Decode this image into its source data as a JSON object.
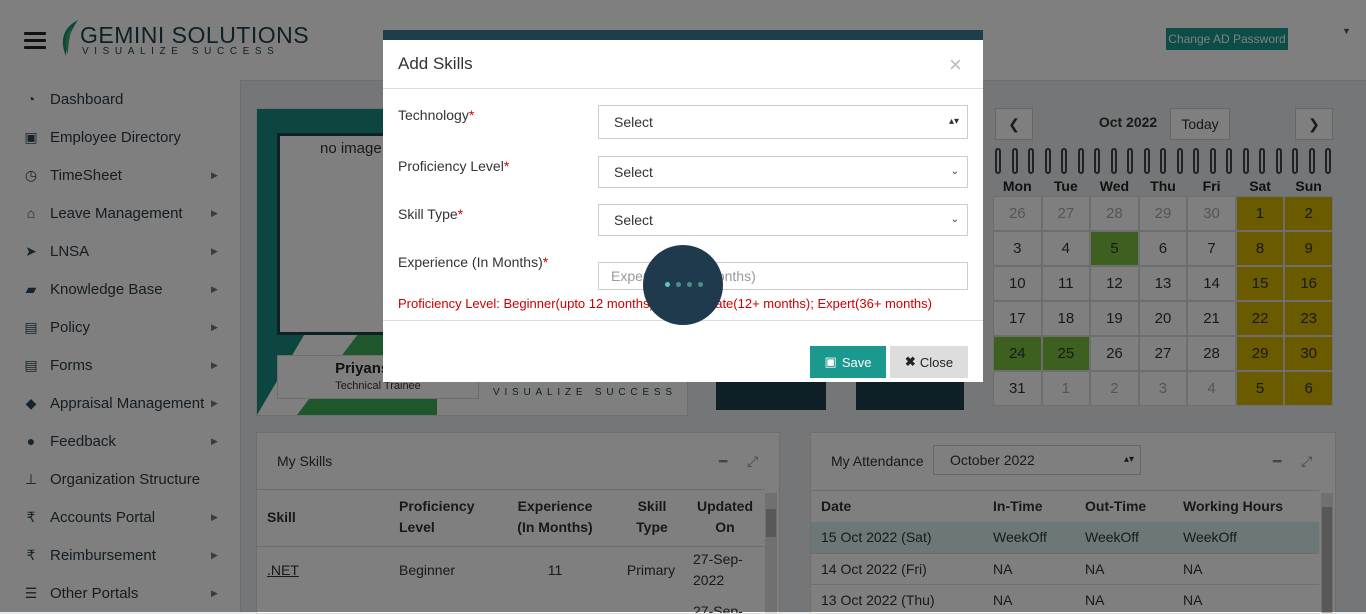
{
  "header": {
    "logo_name": "GEMINI SOLUTIONS",
    "logo_tagline": "VISUALIZE SUCCESS",
    "change_password_label": "Change AD Password"
  },
  "sidebar": {
    "items": [
      {
        "label": "Dashboard",
        "icon": "dashboard-icon"
      },
      {
        "label": "Employee Directory",
        "icon": "id-card-icon"
      },
      {
        "label": "TimeSheet",
        "icon": "clock-icon"
      },
      {
        "label": "Leave Management",
        "icon": "home-icon"
      },
      {
        "label": "LNSA",
        "icon": "send-icon"
      },
      {
        "label": "Knowledge Base",
        "icon": "folder-open-icon"
      },
      {
        "label": "Policy",
        "icon": "file-icon"
      },
      {
        "label": "Forms",
        "icon": "document-icon"
      },
      {
        "label": "Appraisal Management",
        "icon": "graduation-cap-icon"
      },
      {
        "label": "Feedback",
        "icon": "comments-icon"
      },
      {
        "label": "Organization Structure",
        "icon": "sitemap-icon"
      },
      {
        "label": "Accounts Portal",
        "icon": "rupee-icon"
      },
      {
        "label": "Reimbursement",
        "icon": "rupee-icon"
      },
      {
        "label": "Other Portals",
        "icon": "list-icon"
      }
    ]
  },
  "profile": {
    "image_alt": "no image",
    "name": "Priyanshu F",
    "designation": "Technical Trainee",
    "tagline": "VISUALIZE SUCCESS"
  },
  "calendar": {
    "title": "Oct 2022",
    "today_label": "Today",
    "prev_label": "❮",
    "next_label": "❯",
    "days": [
      "Mon",
      "Tue",
      "Wed",
      "Thu",
      "Fri",
      "Sat",
      "Sun"
    ],
    "weeks": [
      [
        "26",
        "27",
        "28",
        "29",
        "30",
        "1",
        "2"
      ],
      [
        "3",
        "4",
        "5",
        "6",
        "7",
        "8",
        "9"
      ],
      [
        "10",
        "11",
        "12",
        "13",
        "14",
        "15",
        "16"
      ],
      [
        "17",
        "18",
        "19",
        "20",
        "21",
        "22",
        "23"
      ],
      [
        "24",
        "25",
        "26",
        "27",
        "28",
        "29",
        "30"
      ],
      [
        "31",
        "1",
        "2",
        "3",
        "4",
        "5",
        "6"
      ]
    ]
  },
  "skills": {
    "title": "My Skills",
    "headers": [
      "Skill",
      "Proficiency Level",
      "Experience (In Months)",
      "Skill Type",
      "Updated On"
    ],
    "rows": [
      {
        "skill": ".NET",
        "level": "Beginner",
        "experience": "11",
        "type": "Primary",
        "updated": "27-Sep-2022"
      },
      {
        "updated_partial": "27-Sep-"
      }
    ]
  },
  "attendance": {
    "title": "My Attendance",
    "month_select": "October 2022",
    "headers": [
      "Date",
      "In-Time",
      "Out-Time",
      "Working Hours"
    ],
    "rows": [
      {
        "date": "15 Oct 2022 (Sat)",
        "in": "WeekOff",
        "out": "WeekOff",
        "hours": "WeekOff"
      },
      {
        "date": "14 Oct 2022 (Fri)",
        "in": "NA",
        "out": "NA",
        "hours": "NA"
      },
      {
        "date": "13 Oct 2022 (Thu)",
        "in": "NA",
        "out": "NA",
        "hours": "NA"
      }
    ]
  },
  "modal": {
    "title": "Add Skills",
    "close_x": "×",
    "fields": {
      "technology": {
        "label": "Technology",
        "value": "Select"
      },
      "proficiency": {
        "label": "Proficiency Level",
        "value": "Select"
      },
      "skill_type": {
        "label": "Skill Type",
        "value": "Select"
      },
      "experience": {
        "label": "Experience (In Months)",
        "placeholder": "Experience (In Months)"
      }
    },
    "required_mark": "*",
    "hint": "Proficiency Level: Beginner(upto 12 months); Intermediate(12+ months); Expert(36+ months)",
    "save_label": "Save",
    "close_label": "Close"
  },
  "colors": {
    "accent": "#1a9a8e",
    "brand_dark": "#1d3e4a",
    "weekend": "#d4b400",
    "present": "#7ac143",
    "error": "#cc0000"
  }
}
